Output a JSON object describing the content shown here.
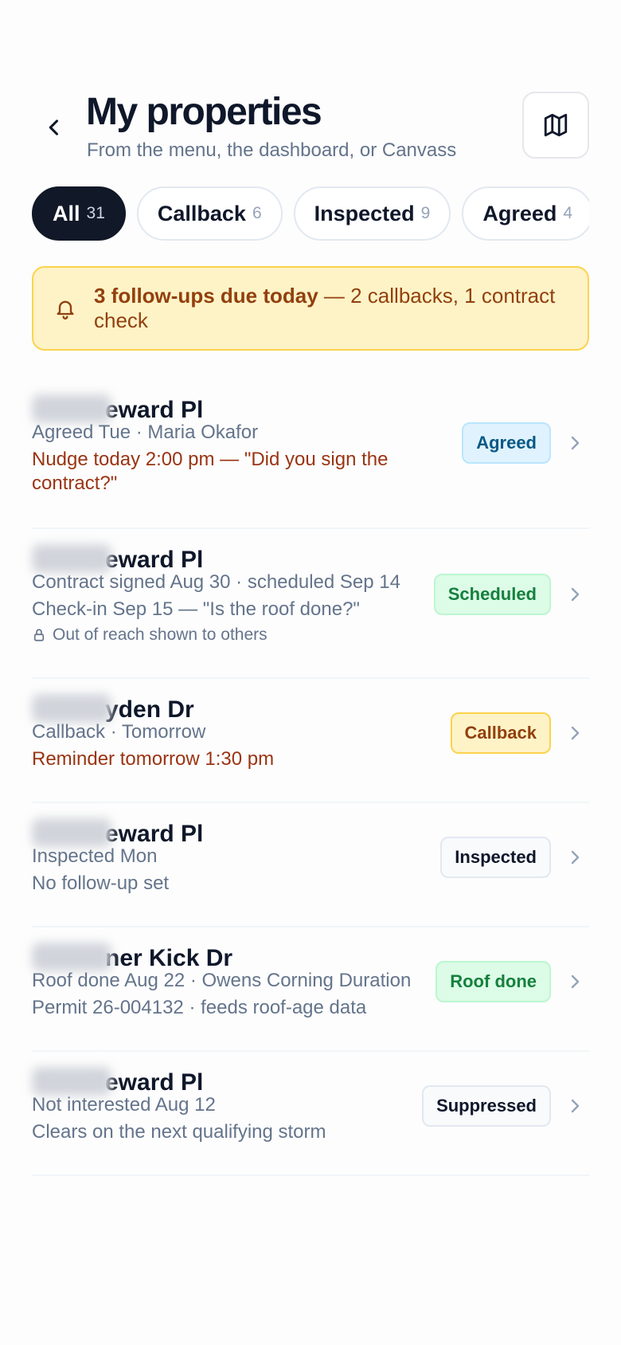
{
  "header": {
    "title": "My properties",
    "subtitle": "From the menu, the dashboard, or Canvass",
    "back_icon": "chevron-left-icon",
    "map_icon": "map-icon"
  },
  "filters": [
    {
      "label": "All",
      "count": "31",
      "active": true
    },
    {
      "label": "Callback",
      "count": "6",
      "active": false
    },
    {
      "label": "Inspected",
      "count": "9",
      "active": false
    },
    {
      "label": "Agreed",
      "count": "4",
      "active": false
    }
  ],
  "alert": {
    "icon": "bell-icon",
    "strong": "3 follow-ups due today",
    "rest": " — 2 callbacks, 1 contract check"
  },
  "properties": [
    {
      "address_visible": "eward Pl",
      "lines": [
        {
          "text": "Agreed Tue · Maria Okafor",
          "style": "muted"
        },
        {
          "text": "Nudge today 2:00 pm — \"Did you sign the",
          "style": "orange"
        },
        {
          "text": "contract?\"",
          "style": "orange"
        }
      ],
      "badge": {
        "label": "Agreed",
        "variant": "agreed"
      }
    },
    {
      "address_visible": "eward Pl",
      "lines": [
        {
          "text": "Contract signed Aug 30 · scheduled Sep 14",
          "style": "muted"
        },
        {
          "text": "Check-in Sep 15 — \"Is the roof done?\"",
          "style": "muted"
        },
        {
          "text": "Out of reach shown to others",
          "style": "small",
          "icon": "lock-icon"
        }
      ],
      "badge": {
        "label": "Scheduled",
        "variant": "scheduled"
      }
    },
    {
      "address_visible": "yden Dr",
      "lines": [
        {
          "text": "Callback · Tomorrow",
          "style": "muted"
        },
        {
          "text": "Reminder tomorrow 1:30 pm",
          "style": "orange"
        }
      ],
      "badge": {
        "label": "Callback",
        "variant": "callback"
      }
    },
    {
      "address_visible": "eward Pl",
      "lines": [
        {
          "text": "Inspected Mon",
          "style": "muted"
        },
        {
          "text": "No follow-up set",
          "style": "muted"
        }
      ],
      "badge": {
        "label": "Inspected",
        "variant": "inspected"
      }
    },
    {
      "address_visible": "ner Kick Dr",
      "lines": [
        {
          "text": "Roof done Aug 22 · Owens Corning Duration",
          "style": "muted"
        },
        {
          "text": "Permit 26-004132 · feeds roof-age data",
          "style": "muted"
        }
      ],
      "badge": {
        "label": "Roof done",
        "variant": "roofdone"
      }
    },
    {
      "address_visible": "eward Pl",
      "lines": [
        {
          "text": "Not interested Aug 12",
          "style": "muted"
        },
        {
          "text": "Clears on the next qualifying storm",
          "style": "muted"
        }
      ],
      "badge": {
        "label": "Suppressed",
        "variant": "suppressed"
      }
    }
  ],
  "colors": {
    "ink": "#0f172a",
    "muted": "#64748b",
    "accent_orange": "#9a3412",
    "alert_bg": "#fef3c7"
  }
}
